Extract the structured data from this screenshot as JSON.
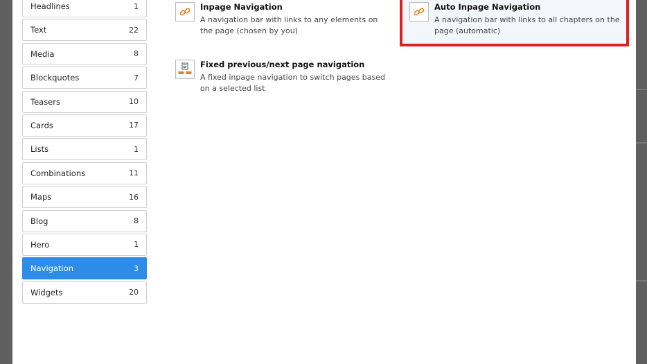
{
  "sidebar": {
    "items": [
      {
        "label": "Headlines",
        "count": "1"
      },
      {
        "label": "Text",
        "count": "22"
      },
      {
        "label": "Media",
        "count": "8"
      },
      {
        "label": "Blockquotes",
        "count": "7"
      },
      {
        "label": "Teasers",
        "count": "10"
      },
      {
        "label": "Cards",
        "count": "17"
      },
      {
        "label": "Lists",
        "count": "1"
      },
      {
        "label": "Combinations",
        "count": "11"
      },
      {
        "label": "Maps",
        "count": "16"
      },
      {
        "label": "Blog",
        "count": "8"
      },
      {
        "label": "Hero",
        "count": "1"
      },
      {
        "label": "Navigation",
        "count": "3",
        "active": true
      },
      {
        "label": "Widgets",
        "count": "20"
      }
    ]
  },
  "elements": {
    "inpage": {
      "title": "Inpage Navigation",
      "desc1": "A navigation bar with links to any elements on",
      "desc2": "the page (chosen by you)",
      "icon": "link-icon"
    },
    "auto_inpage": {
      "title": "Auto Inpage Navigation",
      "desc1": "A navigation bar with links to all chapters on the",
      "desc2": "page (automatic)",
      "icon": "link-icon"
    },
    "fixed_prevnext": {
      "title": "Fixed previous/next page navigation",
      "desc1": "A fixed inpage navigation to switch pages based",
      "desc2": "on a selected list",
      "icon": "page-navigation-icon"
    }
  },
  "colors": {
    "active": "#2d8ce8",
    "highlight_border": "#e02020",
    "icon_accent": "#e8821e"
  }
}
